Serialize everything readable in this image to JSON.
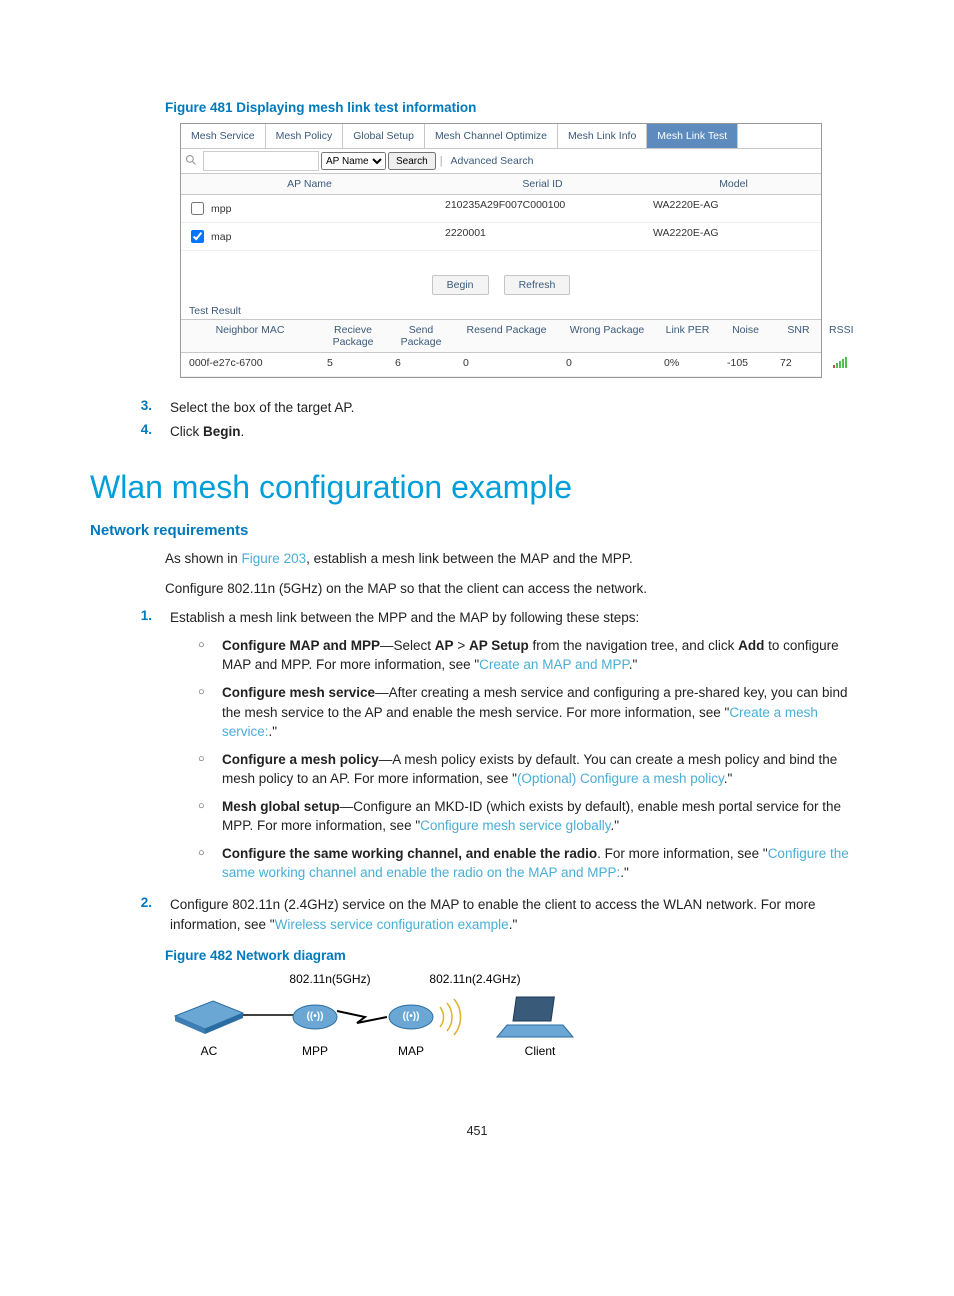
{
  "figure481": {
    "caption": "Figure 481 Displaying mesh link test information",
    "tabs": [
      "Mesh Service",
      "Mesh Policy",
      "Global Setup",
      "Mesh Channel Optimize",
      "Mesh Link Info",
      "Mesh Link Test"
    ],
    "search": {
      "dropdown": "AP Name",
      "button": "Search",
      "advanced": "Advanced Search"
    },
    "ap_table": {
      "headers": [
        "AP Name",
        "Serial ID",
        "Model"
      ],
      "rows": [
        {
          "checked": false,
          "ap": "mpp",
          "serial": "210235A29F007C000100",
          "model": "WA2220E-AG"
        },
        {
          "checked": true,
          "ap": "map",
          "serial": "2220001",
          "model": "WA2220E-AG"
        }
      ]
    },
    "buttons": [
      "Begin",
      "Refresh"
    ],
    "test_result_label": "Test Result",
    "result_headers": [
      "Neighbor MAC",
      "Recieve Package",
      "Send Package",
      "Resend Package",
      "Wrong Package",
      "Link PER",
      "Noise",
      "SNR",
      "RSSI"
    ],
    "result_row": {
      "mac": "000f-e27c-6700",
      "recieve": "5",
      "send": "6",
      "resend": "0",
      "wrong": "0",
      "per": "0%",
      "noise": "-105",
      "snr": "72"
    }
  },
  "steps_before": [
    {
      "num": "3.",
      "text": "Select the box of the target AP."
    },
    {
      "num": "4.",
      "text_pre": "Click ",
      "bold": "Begin",
      "text_post": "."
    }
  ],
  "h1": "Wlan mesh configuration example",
  "h2": "Network requirements",
  "para1_pre": "As shown in ",
  "para1_link": "Figure 203",
  "para1_post": ", establish a mesh link between the MAP and the MPP.",
  "para2": "Configure 802.11n (5GHz) on the MAP so that the client can access the network.",
  "step1": {
    "num": "1.",
    "text": "Establish a mesh link between the MPP and the MAP by following these steps:"
  },
  "sub_items": [
    {
      "b": "Configure MAP and MPP",
      "mid": "—Select ",
      "b2": "AP",
      "gt": " > ",
      "b3": "AP Setup",
      "mid2": " from the navigation tree, and click ",
      "b4": "Add",
      "mid3": " to configure MAP and MPP. For more information, see \"",
      "link": "Create an MAP and MPP",
      "end": ".\" "
    },
    {
      "b": "Configure mesh service",
      "mid": "—After creating a mesh service and configuring a pre-shared key, you can bind the mesh service to the AP and enable the mesh service. For more information, see \"",
      "link": "Create a mesh service:",
      "end": ".\" "
    },
    {
      "b": "Configure a mesh policy",
      "mid": "—A mesh policy exists by default. You can create a mesh policy and bind the mesh policy to an AP. For more information, see \"",
      "link": "(Optional) Configure a mesh policy",
      "end": ".\" "
    },
    {
      "b": "Mesh global setup",
      "mid": "—Configure an MKD-ID (which exists by default), enable mesh portal service for the MPP. For more information, see \"",
      "link": "Configure mesh service globally",
      "end": ".\" "
    },
    {
      "b": "Configure the same working channel, and enable the radio",
      "mid": ". For more information, see \"",
      "link": "Configure the same working channel and enable the radio on the MAP and MPP:",
      "end": ".\" "
    }
  ],
  "step2": {
    "num": "2.",
    "text_pre": "Configure 802.11n (2.4GHz) service on the MAP to enable the client to access the WLAN network. For more information, see \"",
    "link": "Wireless service configuration example",
    "text_post": ".\" "
  },
  "figure482": {
    "caption": "Figure 482 Network diagram",
    "top_labels": [
      "802.11n(5GHz)",
      "802.11n(2.4GHz)"
    ],
    "bottom_labels": [
      "AC",
      "MPP",
      "MAP",
      "Client"
    ]
  },
  "page_number": "451"
}
